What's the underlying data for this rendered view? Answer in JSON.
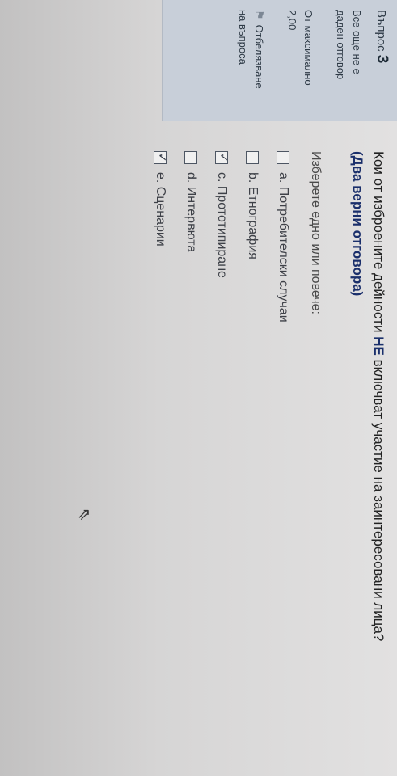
{
  "sidebar": {
    "question_label": "Въпрос",
    "question_number": "3",
    "status_line1": "Все още не е",
    "status_line2": "даден отговор",
    "marks_line1": "От максимално",
    "marks_line2": "2,00",
    "flag_line1": "Отбелязване",
    "flag_line2": "на въпроса",
    "flag_icon": "flag-icon"
  },
  "question": {
    "text_before": "Кои от изброените дейности ",
    "text_highlight": "НЕ",
    "text_after": " включват участие на заинтересовани лица?",
    "note": "(Два верни отговора)",
    "instruction": "Изберете едно или повече:"
  },
  "options": [
    {
      "label": "a. Потребителски случаи",
      "checked": false
    },
    {
      "label": "b. Етнография",
      "checked": false
    },
    {
      "label": "c. Прототипиране",
      "checked": true
    },
    {
      "label": "d. Интервюта",
      "checked": false
    },
    {
      "label": "e. Сценарии",
      "checked": true
    }
  ],
  "cursor_icon": "mouse-cursor-icon"
}
